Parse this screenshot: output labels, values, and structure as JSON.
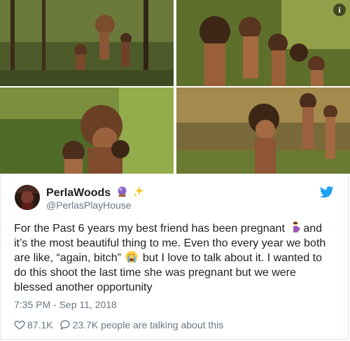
{
  "tweet": {
    "display_name": "PerlaWoods",
    "name_emojis": [
      "crystal-ball-emoji",
      "sparkles-emoji"
    ],
    "handle": "@PerlasPlayHouse",
    "text_parts": [
      "For the Past 6 years my best friend has been pregnant ",
      "and it’s the most beautiful thing to me. Even tho every year we both are like, “again, bitch” ",
      " but I love to talk about it. I wanted to do this shoot the last time she was pregnant but we were blessed another opportunity"
    ],
    "inline_emojis": [
      "pregnant-woman-emoji",
      "crying-face-emoji"
    ],
    "timestamp": "7:35 PM - Sep 11, 2018",
    "likes": "87.1K",
    "conversation": "23.7K people are talking about this"
  },
  "media": {
    "photo_count": 4,
    "info_glyph": "i"
  },
  "colors": {
    "twitter_blue": "#1da1f2",
    "text": "#1c2022",
    "muted": "#697882",
    "border": "#e1e8ed"
  }
}
